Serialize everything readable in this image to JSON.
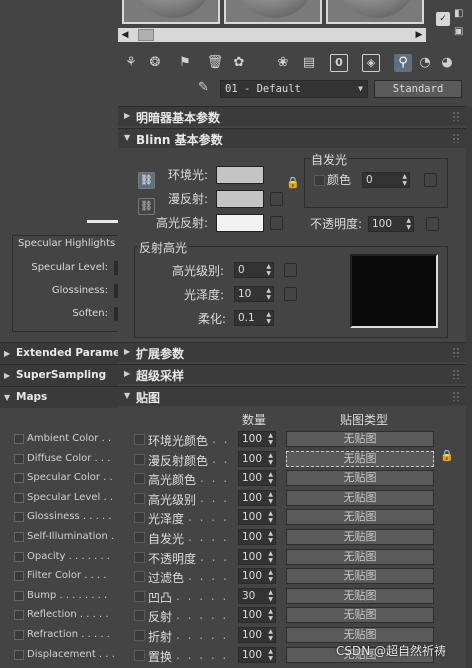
{
  "left_panel": {
    "specular_group_title": "Specular Highlights",
    "specular_level_label": "Specular Level:",
    "glossiness_label": "Glossiness:",
    "soften_label": "Soften:",
    "rollouts": [
      "Extended Parame",
      "SuperSampling",
      "Maps"
    ],
    "maps": [
      "Ambient Color . .",
      "Diffuse Color . . .",
      "Specular Color . .",
      "Specular Level . .",
      "Glossiness . . . . .",
      "Self-Illumination .",
      "Opacity . . . . . . .",
      "Filter Color . . . .",
      "Bump . . . . . . . .",
      "Reflection . . . . .",
      "Refraction . . . . .",
      "Displacement . . ."
    ]
  },
  "top": {
    "material_name": "01 - Default",
    "material_type": "Standard",
    "slot_prev_arrow": "◀",
    "slot_next_arrow": "▶",
    "toolbar_icons": [
      "get-material-icon",
      "put-to-scene-icon",
      "assign-material-icon",
      "reset-map-icon",
      "make-unique-icon",
      "put-to-library-icon",
      "material-id-icon",
      "show-map-icon",
      "show-end-result-icon",
      "go-to-parent-icon",
      "go-forward-sibling-icon"
    ],
    "material_id_channel": "0"
  },
  "shader_basic": {
    "title": "明暗器基本参数"
  },
  "blinn_basic": {
    "title": "Blinn 基本参数",
    "ambient_label": "环境光:",
    "diffuse_label": "漫反射:",
    "specular_label": "高光反射:",
    "ambient_color": "#c4c4c4",
    "diffuse_color": "#c4c4c4",
    "specular_color": "#f2f2f2",
    "self_illum_title": "自发光",
    "self_illum_color_label": "颜色",
    "self_illum_value": "0",
    "opacity_label": "不透明度:",
    "opacity_value": "100",
    "spec_highlights_title": "反射高光",
    "spec_level_label": "高光级别:",
    "spec_level_value": "0",
    "glossiness_label": "光泽度:",
    "glossiness_value": "10",
    "soften_label": "柔化:",
    "soften_value": "0.1"
  },
  "extended": {
    "title": "扩展参数"
  },
  "supersampling": {
    "title": "超级采样"
  },
  "maps": {
    "title": "贴图",
    "amount_header": "数量",
    "map_type_header": "贴图类型",
    "rows": [
      {
        "label": "环境光颜色",
        "dots": ". .",
        "amount": "100",
        "map": "无贴图"
      },
      {
        "label": "漫反射颜色",
        "dots": ". .",
        "amount": "100",
        "map": "无贴图"
      },
      {
        "label": "高光颜色",
        "dots": ". . .",
        "amount": "100",
        "map": "无贴图"
      },
      {
        "label": "高光级别",
        "dots": ". . .",
        "amount": "100",
        "map": "无贴图"
      },
      {
        "label": "光泽度",
        "dots": ". . . .",
        "amount": "100",
        "map": "无贴图"
      },
      {
        "label": "自发光",
        "dots": ". . . .",
        "amount": "100",
        "map": "无贴图"
      },
      {
        "label": "不透明度",
        "dots": ". . .",
        "amount": "100",
        "map": "无贴图"
      },
      {
        "label": "过滤色",
        "dots": ". . . .",
        "amount": "100",
        "map": "无贴图"
      },
      {
        "label": "凹凸",
        "dots": ". . . . .",
        "amount": "30",
        "map": "无贴图"
      },
      {
        "label": "反射",
        "dots": ". . . . .",
        "amount": "100",
        "map": "无贴图"
      },
      {
        "label": "折射",
        "dots": ". . . . .",
        "amount": "100",
        "map": "无贴图"
      },
      {
        "label": "置换",
        "dots": ". . . . .",
        "amount": "100",
        "map": "无贴图"
      }
    ]
  },
  "watermark": "CSDN @超自然祈祷"
}
